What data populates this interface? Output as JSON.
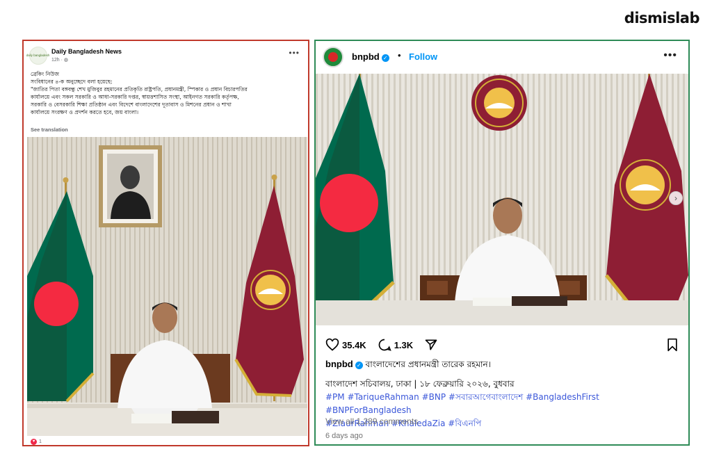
{
  "brand": "dismislab",
  "facebook": {
    "page_name": "Daily Bangladesh News",
    "avatar_text": "daily bangladesh",
    "time": "12h ·",
    "globe": "◍",
    "more": "•••",
    "body_lines": [
      "ব্রেকিং নিউজ",
      "সংবিধানের ৪-ক অনুচ্ছেদে বলা হয়েছে:",
      "\"জাতির পিতা বঙ্গবন্ধু শেখ মুজিবুর রহমানের প্রতিকৃতি রাষ্ট্রপতি, প্রধানমন্ত্রী, স্পিকার ও প্রধান বিচারপতির",
      "কার্যালয়ে এবং সকল সরকারি ও আধা-সরকারি দপ্তর, স্বায়ত্তশাসিত সংস্থা, আইনগত সরকারি কর্তৃপক্ষ,",
      "সরকারি ও বেসরকারি শিক্ষা প্রতিষ্ঠান এবং বিদেশে বাংলাদেশের দূতাবাস ও মিশনের প্রধান ও শাখা",
      "কার্যালয়ে সংরক্ষণ ও প্রদর্শন করতে হবে, জয় বাংলা।"
    ],
    "see_translation": "See translation",
    "reaction_icon": "♥",
    "reaction_count": "1"
  },
  "instagram": {
    "username": "bnpbd",
    "verified_mark": "✓",
    "sep": "•",
    "follow": "Follow",
    "more": "•••",
    "next_arrow": "›",
    "likes": "35.4K",
    "comments": "1.3K",
    "caption_user": "bnpbd",
    "caption_text": "বাংলাদেশের প্রধানমন্ত্রী তারেক রহমান।",
    "location_line": "বাংলাদেশ সচিবালয়, ঢাকা | ১৮ ফেব্রুয়ারি ২০২৬, বুধবার",
    "hashtags_line1": "#PM #TariqueRahman #BNP #সবারআগেবাংলাদেশ #BangladeshFirst #BNPForBangladesh",
    "hashtags_line2": "#ZiaurRahman #KhaledaZia #বিএনপি",
    "view_comments": "View all 1,289 comments",
    "time_ago": "6 days ago"
  },
  "colors": {
    "left_border": "#c0392b",
    "right_border": "#2e8b57",
    "link_blue": "#0095f6",
    "hashtag_blue": "#3b57d9",
    "flag_green": "#006a4e",
    "flag_red": "#f42a41",
    "maroon_flag": "#8e1e34"
  }
}
